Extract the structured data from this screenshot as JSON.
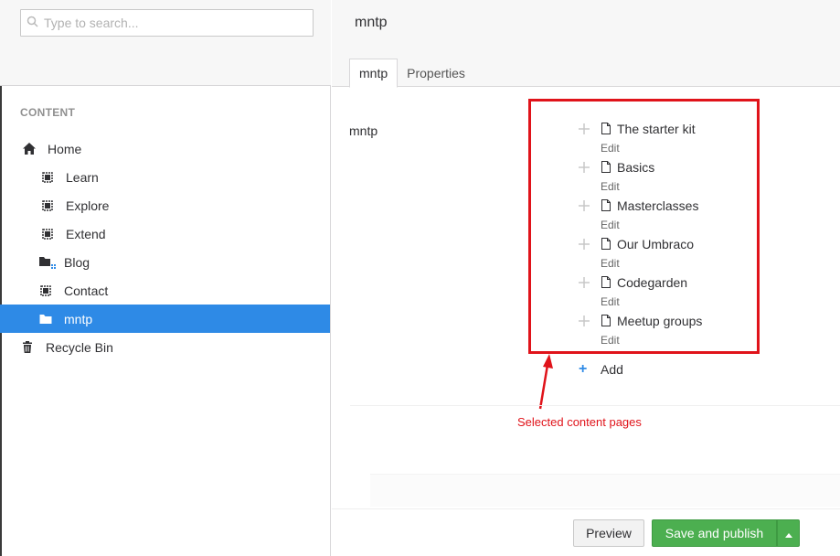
{
  "search": {
    "placeholder": "Type to search..."
  },
  "sidebar": {
    "section_title": "CONTENT",
    "items": [
      {
        "label": "Home",
        "icon": "home-icon"
      },
      {
        "label": "Learn",
        "icon": "grid-page-icon"
      },
      {
        "label": "Explore",
        "icon": "grid-page-icon"
      },
      {
        "label": "Extend",
        "icon": "grid-page-icon"
      },
      {
        "label": "Blog",
        "icon": "folder-icon"
      },
      {
        "label": "Contact",
        "icon": "grid-page-icon"
      },
      {
        "label": "mntp",
        "icon": "folder-icon",
        "active": true
      },
      {
        "label": "Recycle Bin",
        "icon": "trash-icon"
      }
    ]
  },
  "header": {
    "node_name": "mntp",
    "tabs": [
      {
        "label": "mntp",
        "active": true
      },
      {
        "label": "Properties",
        "active": false
      }
    ]
  },
  "property": {
    "label": "mntp",
    "picked_items": [
      {
        "title": "The starter kit",
        "edit": "Edit"
      },
      {
        "title": "Basics",
        "edit": "Edit"
      },
      {
        "title": "Masterclasses",
        "edit": "Edit"
      },
      {
        "title": "Our Umbraco",
        "edit": "Edit"
      },
      {
        "title": "Codegarden",
        "edit": "Edit"
      },
      {
        "title": "Meetup groups",
        "edit": "Edit"
      }
    ],
    "add_label": "Add"
  },
  "annotation": {
    "text": "Selected content pages",
    "color": "#e0131a"
  },
  "footer": {
    "preview_label": "Preview",
    "publish_label": "Save and publish"
  },
  "colors": {
    "active": "#2e8ae6",
    "publish": "#4caf50"
  }
}
